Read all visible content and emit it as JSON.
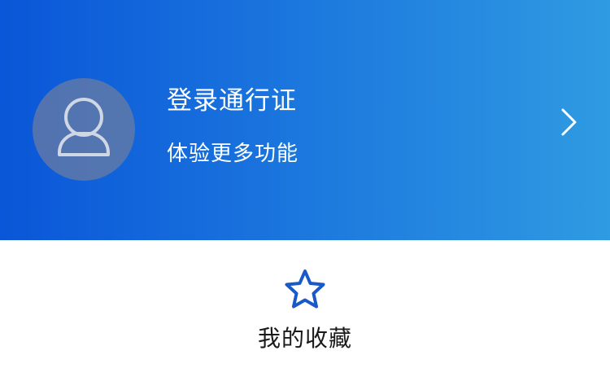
{
  "header": {
    "title": "登录通行证",
    "subtitle": "体验更多功能",
    "avatar_icon": "user-avatar-icon",
    "arrow_icon": "chevron-right-icon",
    "gradient_start": "#0a56d8",
    "gradient_end": "#2f9be2"
  },
  "favorites": {
    "label": "我的收藏",
    "icon": "star-icon",
    "icon_color": "#1a5ac8"
  }
}
